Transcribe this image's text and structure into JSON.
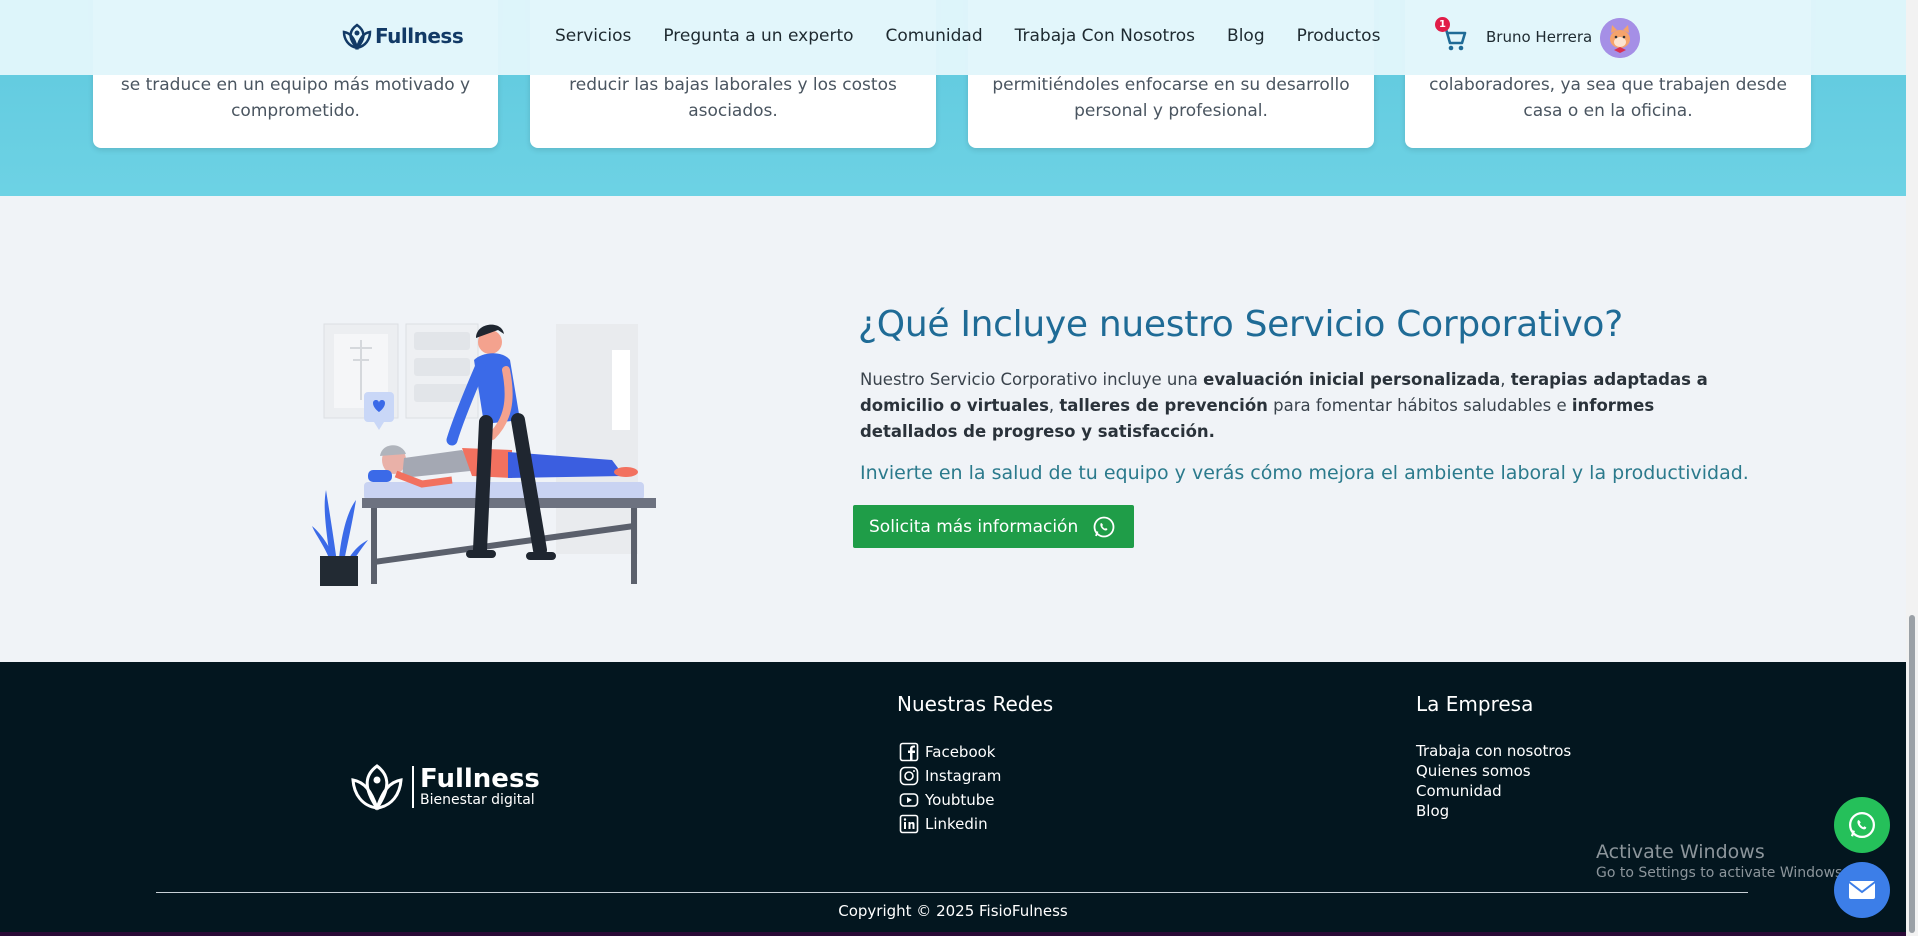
{
  "cards": [
    {
      "text": "se traduce en un equipo más motivado y comprometido."
    },
    {
      "text": "reducir las bajas laborales y los costos asociados."
    },
    {
      "text": "permitiéndoles enfocarse en su desarrollo personal y profesional."
    },
    {
      "text": "colaboradores, ya sea que trabajen desde casa o en la oficina."
    }
  ],
  "nav": {
    "logo_text": "Fullness",
    "items": [
      "Servicios",
      "Pregunta a un experto",
      "Comunidad",
      "Trabaja Con Nosotros",
      "Blog",
      "Productos"
    ],
    "cart_count": "1",
    "user_name": "Bruno Herrera"
  },
  "corporate": {
    "title": "¿Qué Incluye nuestro Servicio Corporativo?",
    "desc_1": "Nuestro Servicio Corporativo incluye una ",
    "desc_b1": "evaluación inicial personalizada",
    "desc_2": ", ",
    "desc_b2": "terapias adaptadas a domicilio o virtuales",
    "desc_3": ", ",
    "desc_b3": "talleres de prevención",
    "desc_4": " para fomentar hábitos saludables e ",
    "desc_b4": "informes detallados de progreso y satisfacción.",
    "invest": "Invierte en la salud de tu equipo y verás cómo mejora el ambiente laboral y la productividad.",
    "cta_label": "Solicita más información"
  },
  "footer": {
    "logo_main": "Fullness",
    "logo_sub": "Bienestar digital",
    "social_heading": "Nuestras Redes",
    "social": [
      {
        "label": "Facebook",
        "icon": "facebook-icon"
      },
      {
        "label": "Instagram",
        "icon": "instagram-icon"
      },
      {
        "label": "Youbtube",
        "icon": "youtube-icon"
      },
      {
        "label": "Linkedin",
        "icon": "linkedin-icon"
      }
    ],
    "company_heading": "La Empresa",
    "company_links": [
      "Trabaja con nosotros",
      "Quienes somos",
      "Comunidad",
      "Blog"
    ],
    "copyright": "Copyright © 2025 FisioFulness"
  },
  "windows": {
    "line1": "Activate Windows",
    "line2": "Go to Settings to activate Windows."
  },
  "colors": {
    "band": "#6dd2e4",
    "title": "#1f6b96",
    "cta": "#1f9d48",
    "footer": "#03161f",
    "whatsapp": "#25c05a",
    "mail": "#3c7ee8"
  }
}
